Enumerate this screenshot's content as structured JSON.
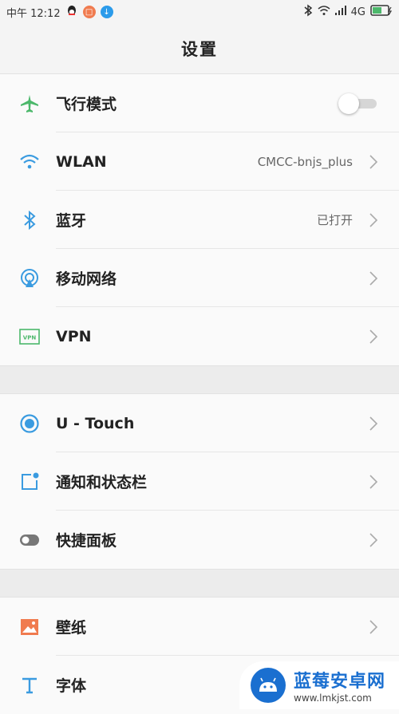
{
  "status": {
    "time": "中午 12:12",
    "network": "4G",
    "icons": [
      "qq-icon",
      "orange-app-icon",
      "blue-download-icon",
      "bluetooth-icon",
      "wifi-icon",
      "signal-icon",
      "battery-icon"
    ]
  },
  "header": {
    "title": "设置"
  },
  "groups": [
    {
      "items": [
        {
          "label": "飞行模式",
          "icon": "airplane-icon",
          "control": "toggle",
          "toggle_on": false
        },
        {
          "label": "WLAN",
          "value": "CMCC-bnjs_plus",
          "icon": "wifi-icon"
        },
        {
          "label": "蓝牙",
          "value": "已打开",
          "icon": "bluetooth-icon"
        },
        {
          "label": "移动网络",
          "icon": "mobile-network-icon"
        },
        {
          "label": "VPN",
          "icon": "vpn-icon"
        }
      ]
    },
    {
      "items": [
        {
          "label": "U - Touch",
          "icon": "utouch-icon"
        },
        {
          "label": "通知和状态栏",
          "icon": "notification-icon"
        },
        {
          "label": "快捷面板",
          "icon": "quick-panel-icon"
        }
      ]
    },
    {
      "items": [
        {
          "label": "壁纸",
          "icon": "wallpaper-icon"
        },
        {
          "label": "字体",
          "icon": "font-icon"
        }
      ]
    }
  ],
  "watermark": {
    "title": "蓝莓安卓网",
    "url": "www.lmkjst.com"
  },
  "colors": {
    "green": "#4cb86b",
    "blue": "#3a9be0",
    "orange": "#f07b4f",
    "gray": "#777777"
  }
}
